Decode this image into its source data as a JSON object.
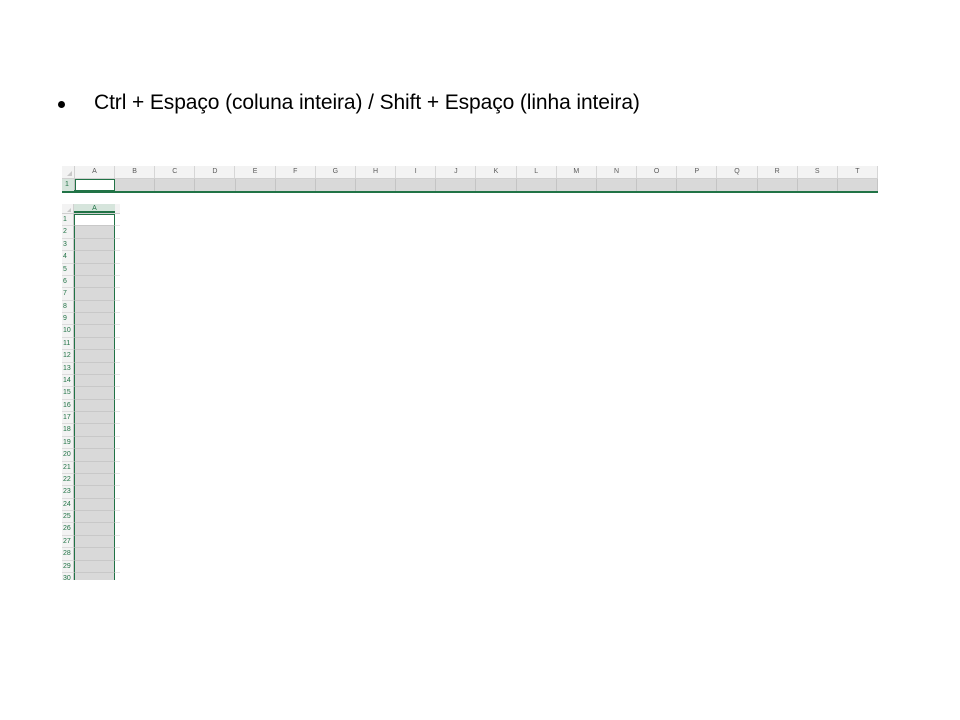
{
  "bullet": {
    "text": "Ctrl + Espaço (coluna inteira) / Shift + Espaço (linha inteira)"
  },
  "row_sheet": {
    "columns": [
      "A",
      "B",
      "C",
      "D",
      "E",
      "F",
      "G",
      "H",
      "I",
      "J",
      "K",
      "L",
      "M",
      "N",
      "O",
      "P",
      "Q",
      "R",
      "S",
      "T"
    ],
    "row_label": "1",
    "active_cell": "A1",
    "selection_color": "#217346"
  },
  "col_sheet": {
    "column": "A",
    "rows": [
      "1",
      "2",
      "3",
      "4",
      "5",
      "6",
      "7",
      "8",
      "9",
      "10",
      "11",
      "12",
      "13",
      "14",
      "15",
      "16",
      "17",
      "18",
      "19",
      "20",
      "21",
      "22",
      "23",
      "24",
      "25",
      "26",
      "27",
      "28",
      "29",
      "30"
    ],
    "active_cell": "A1",
    "selection_color": "#217346"
  }
}
